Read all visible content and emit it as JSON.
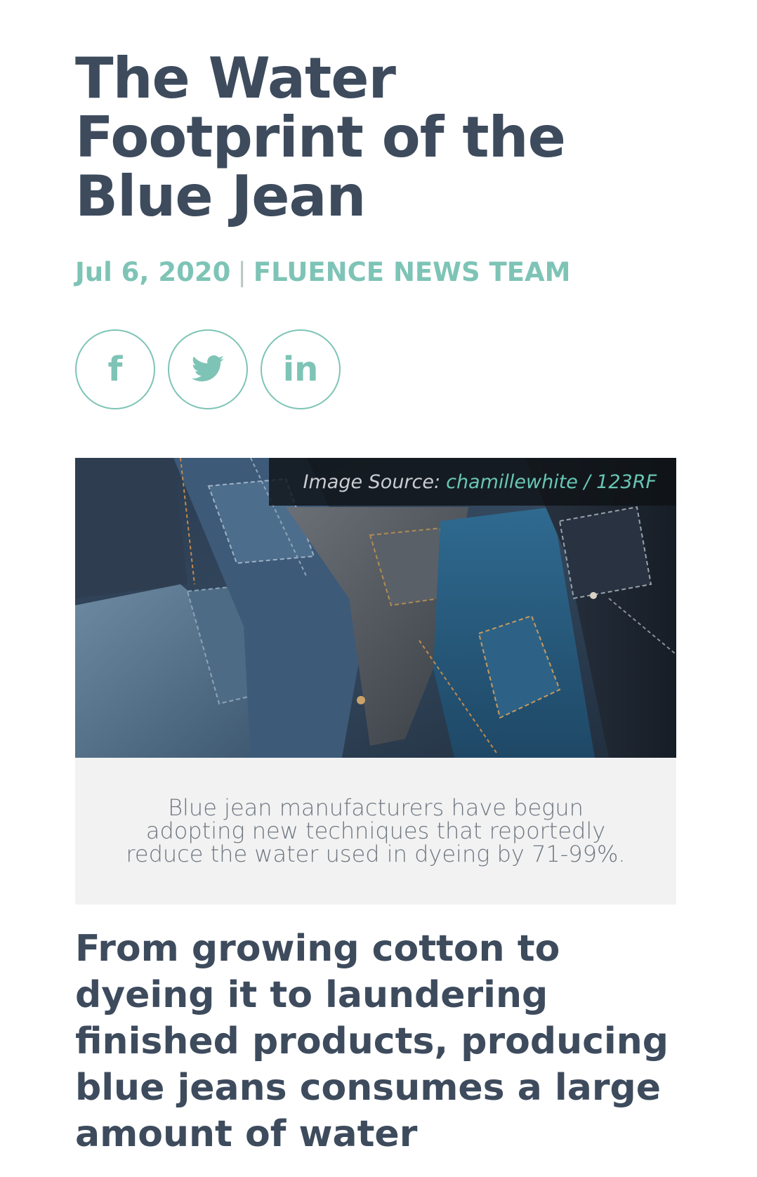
{
  "article": {
    "title": "The Water Footprint of the Blue Jean",
    "date": "Jul 6, 2020",
    "separator": "|",
    "author": "FLUENCE NEWS TEAM",
    "share": {
      "facebook_icon": "facebook-icon",
      "twitter_icon": "twitter-icon",
      "linkedin_icon": "linkedin-icon",
      "facebook_glyph": "f",
      "linkedin_glyph": "in"
    },
    "image": {
      "credit_label": "Image Source:",
      "credit_link": "chamillewhite / 123RF",
      "caption": "Blue jean manufacturers have begun adopting new techniques that reportedly reduce the water used in dyeing by 71-99%."
    },
    "lead": "From growing cotton to dyeing it to laundering finished products, producing blue jeans consumes a large amount of water"
  },
  "colors": {
    "heading": "#3d4b5d",
    "accent": "#7ec4b6",
    "caption_bg": "#f2f2f2"
  }
}
